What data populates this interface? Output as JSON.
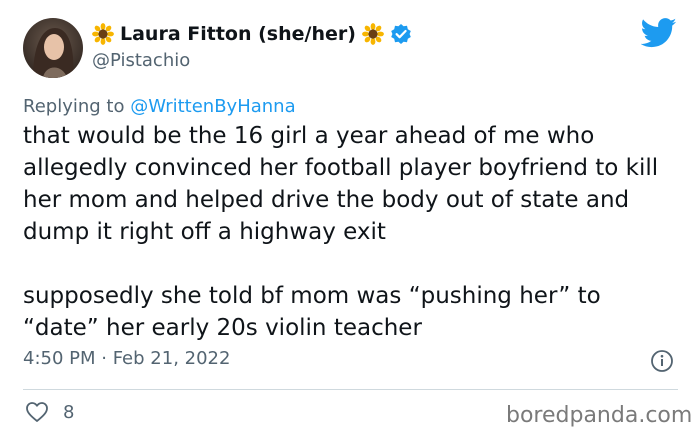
{
  "author": {
    "name": "Laura Fitton (she/her)",
    "handle": "@Pistachio",
    "verified": true,
    "name_emoji_left": "sunflower-icon",
    "name_emoji_right": "sunflower-icon"
  },
  "reply": {
    "prefix": "Replying to",
    "to_handle": "@WrittenByHanna"
  },
  "tweet": {
    "paragraphs": [
      "that would be the 16 girl a year ahead of me who allegedly convinced her football player boyfriend to kill her mom and helped drive the body out of state and dump it right off a highway exit",
      "supposedly she told bf mom was “pushing her” to “date” her early 20s violin teacher"
    ]
  },
  "meta": {
    "timestamp": "4:50 PM · Feb 21, 2022"
  },
  "engagement": {
    "likes": "8"
  },
  "watermark": "boredpanda.com",
  "colors": {
    "twitter_blue": "#1d9bf0",
    "secondary_text": "#536471",
    "primary_text": "#0f1419"
  }
}
